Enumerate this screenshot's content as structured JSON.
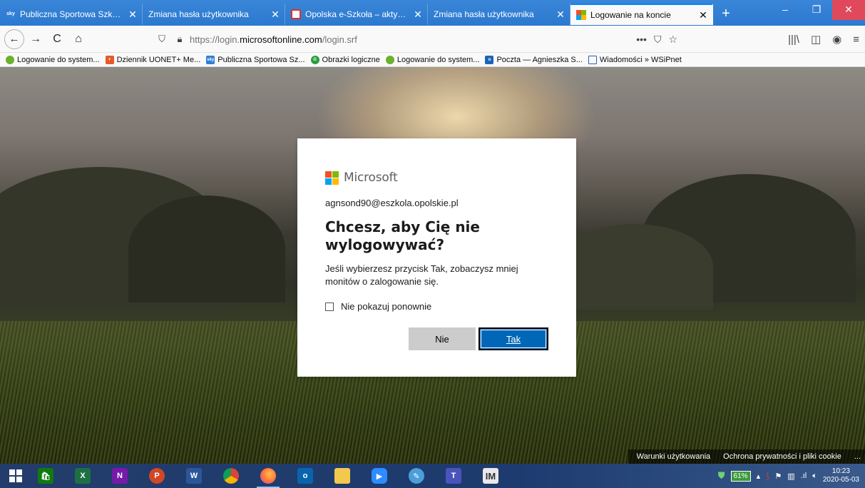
{
  "tabs": [
    {
      "title": "Publiczna Sportowa Szkoła Pod",
      "favicon": "sky-icon",
      "active": false
    },
    {
      "title": "Zmiana hasła użytkownika",
      "favicon": "none",
      "active": false
    },
    {
      "title": "Opolska e-Szkoła – aktywacja k",
      "favicon": "eszkola-icon",
      "active": false
    },
    {
      "title": "Zmiana hasła użytkownika",
      "favicon": "none",
      "active": false
    },
    {
      "title": "Logowanie na koncie",
      "favicon": "microsoft-icon",
      "active": true
    }
  ],
  "tab_close_glyph": "✕",
  "new_tab_glyph": "+",
  "window_controls": {
    "minimize": "–",
    "restore": "❐",
    "close": "✕"
  },
  "nav": {
    "back": "←",
    "forward": "→",
    "reload": "C",
    "home": "⌂",
    "url_prefix": "https://login.",
    "url_domain": "microsoftonline.com",
    "url_suffix": "/login.srf",
    "page_actions": "•••",
    "pocket": "⛉",
    "star": "☆",
    "library": "|||\\",
    "sidebar": "◫",
    "account": "◉",
    "menu": "≡"
  },
  "bookmarks": [
    {
      "label": "Logowanie do system...",
      "icon": "logowanie-icon"
    },
    {
      "label": "Dziennik UONET+ Me...",
      "icon": "uonet-icon"
    },
    {
      "label": "Publiczna Sportowa Sz...",
      "icon": "sky-icon"
    },
    {
      "label": "Obrazki logiczne",
      "icon": "obrazki-icon"
    },
    {
      "label": "Logowanie do system...",
      "icon": "logowanie-icon"
    },
    {
      "label": "Poczta — Agnieszka S...",
      "icon": "outlook-icon"
    },
    {
      "label": "Wiadomości » WSiPnet",
      "icon": "news-icon"
    }
  ],
  "dialog": {
    "brand": "Microsoft",
    "email": "agnsond90@eszkola.opolskie.pl",
    "title": "Chcesz, aby Cię nie wylogowywać?",
    "description": "Jeśli wybierzesz przycisk Tak, zobaczysz mniej monitów o zalogowanie się.",
    "checkbox_label": "Nie pokazuj ponownie",
    "checkbox_checked": false,
    "button_no": "Nie",
    "button_yes": "Tak"
  },
  "footer": {
    "terms": "Warunki użytkowania",
    "privacy": "Ochrona prywatności i pliki cookie",
    "more": "..."
  },
  "taskbar": {
    "apps": [
      {
        "name": "store",
        "label": "",
        "color": "#0f7b0f"
      },
      {
        "name": "excel",
        "label": "X",
        "color": "#1d7044"
      },
      {
        "name": "onenote",
        "label": "N",
        "color": "#7719aa"
      },
      {
        "name": "powerpoint",
        "label": "P",
        "color": "#d24726"
      },
      {
        "name": "word",
        "label": "W",
        "color": "#2b579a"
      },
      {
        "name": "chrome",
        "label": "",
        "color": "#e6a42b"
      },
      {
        "name": "firefox",
        "label": "",
        "color": "#ff7139"
      },
      {
        "name": "outlook",
        "label": "o",
        "color": "#0a64ad"
      },
      {
        "name": "file-explorer",
        "label": "",
        "color": "#f2c94c"
      },
      {
        "name": "zoom",
        "label": "",
        "color": "#2d8cff"
      },
      {
        "name": "paint",
        "label": "",
        "color": "#4a9fd8"
      },
      {
        "name": "teams",
        "label": "T",
        "color": "#4b53bc"
      },
      {
        "name": "im",
        "label": "IM",
        "color": "#e9e9e9"
      }
    ],
    "battery": "61%",
    "time": "10:23",
    "date": "2020-05-03"
  },
  "colors": {
    "ms_red": "#f25022",
    "ms_green": "#7fba00",
    "ms_blue": "#00a4ef",
    "ms_yellow": "#ffb900",
    "button_primary": "#0067b8",
    "button_secondary": "#cccccc"
  }
}
